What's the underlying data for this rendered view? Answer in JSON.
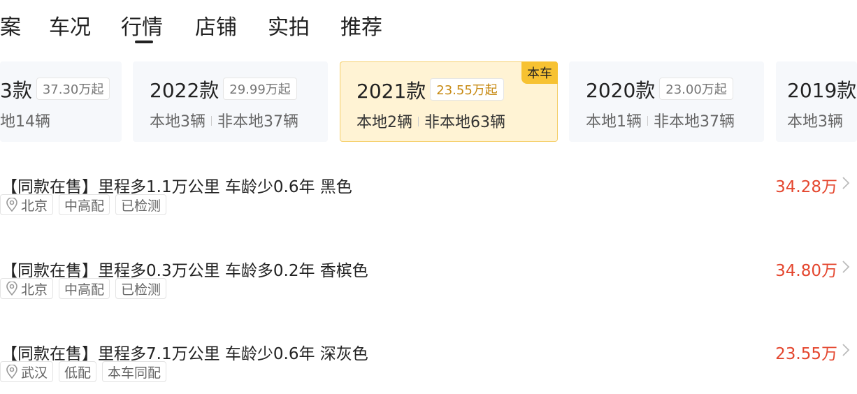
{
  "tabs": [
    {
      "label": "案"
    },
    {
      "label": "车况"
    },
    {
      "label": "行情",
      "active": true
    },
    {
      "label": "店铺"
    },
    {
      "label": "实拍"
    },
    {
      "label": "推荐"
    }
  ],
  "years": [
    {
      "year": "3款",
      "price": "37.30万起",
      "local": "",
      "nonlocal": "地14辆"
    },
    {
      "year": "2022款",
      "price": "29.99万起",
      "local": "本地3辆",
      "nonlocal": "非本地37辆"
    },
    {
      "year": "2021款",
      "price": "23.55万起",
      "local": "本地2辆",
      "nonlocal": "非本地63辆",
      "badge": "本车"
    },
    {
      "year": "2020款",
      "price": "23.00万起",
      "local": "本地1辆",
      "nonlocal": "非本地37辆"
    },
    {
      "year": "2019款",
      "price": "",
      "local": "本地3辆",
      "nonlocal": ""
    }
  ],
  "listings": [
    {
      "title": "【同款在售】里程多1.1万公里 车龄少0.6年 黑色",
      "city": "北京",
      "tags": [
        "中高配",
        "已检测"
      ],
      "price": "34.28万"
    },
    {
      "title": "【同款在售】里程多0.3万公里 车龄多0.2年 香槟色",
      "city": "北京",
      "tags": [
        "中高配",
        "已检测"
      ],
      "price": "34.80万"
    },
    {
      "title": "【同款在售】里程多7.1万公里 车龄少0.6年 深灰色",
      "city": "武汉",
      "tags": [
        "低配",
        "本车同配"
      ],
      "price": "23.55万"
    }
  ],
  "colors": {
    "price": "#e4462e",
    "highlight": "#fff3d4",
    "badge": "#f7c232"
  }
}
